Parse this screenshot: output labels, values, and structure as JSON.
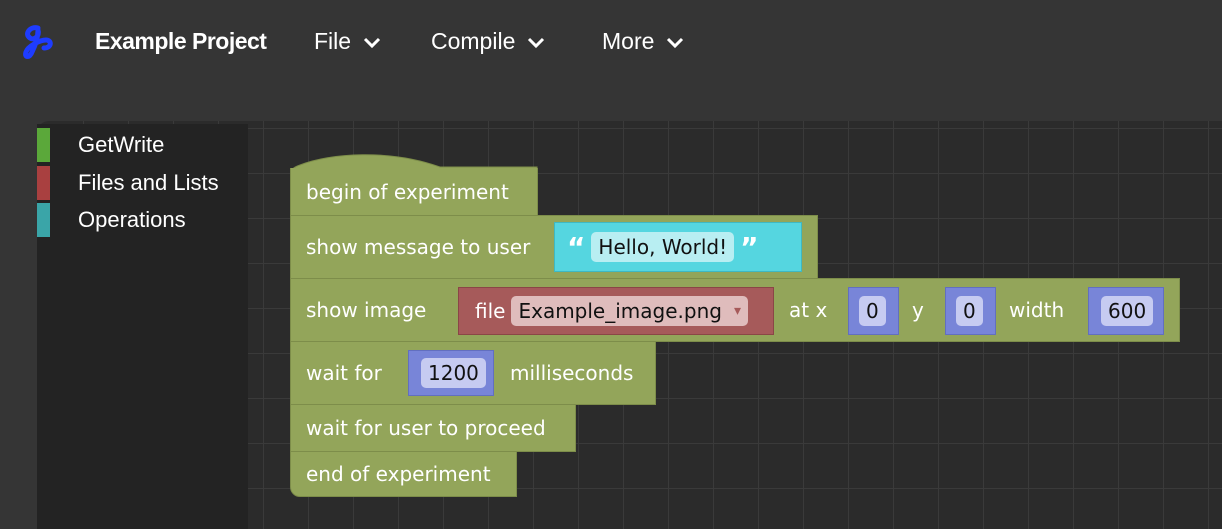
{
  "header": {
    "logo_icon": "script-g-logo",
    "project_title": "Example Project",
    "menus": [
      {
        "label": "File",
        "icon": "chevron-down-icon"
      },
      {
        "label": "Compile",
        "icon": "chevron-down-icon"
      },
      {
        "label": "More",
        "icon": "chevron-down-icon"
      }
    ]
  },
  "toolbox": {
    "categories": [
      {
        "label": "GetWrite",
        "color": "#5ba83a"
      },
      {
        "label": "Files and Lists",
        "color": "#a94040"
      },
      {
        "label": "Operations",
        "color": "#3aa5a8"
      }
    ]
  },
  "blocks": {
    "begin": "begin of experiment",
    "show_message": {
      "label": "show message to user",
      "open_quote": "“",
      "text": "Hello, World!",
      "close_quote": "”"
    },
    "show_image": {
      "label": "show image",
      "file_label": "file",
      "file_value": "Example_image.png",
      "dropdown_arrow": "▾",
      "at_x_label": "at x",
      "x_value": "0",
      "y_label": "y",
      "y_value": "0",
      "width_label": "width",
      "width_value": "600"
    },
    "wait_for": {
      "label": "wait for",
      "value": "1200",
      "unit": "milliseconds"
    },
    "wait_user": "wait for user to proceed",
    "end": "end of experiment"
  },
  "colors": {
    "statement_block": "#93a55a",
    "text_block": "#55d6e0",
    "file_block": "#a65a5a",
    "number_block": "#7885d8",
    "accent_logo": "#1e3cff"
  }
}
